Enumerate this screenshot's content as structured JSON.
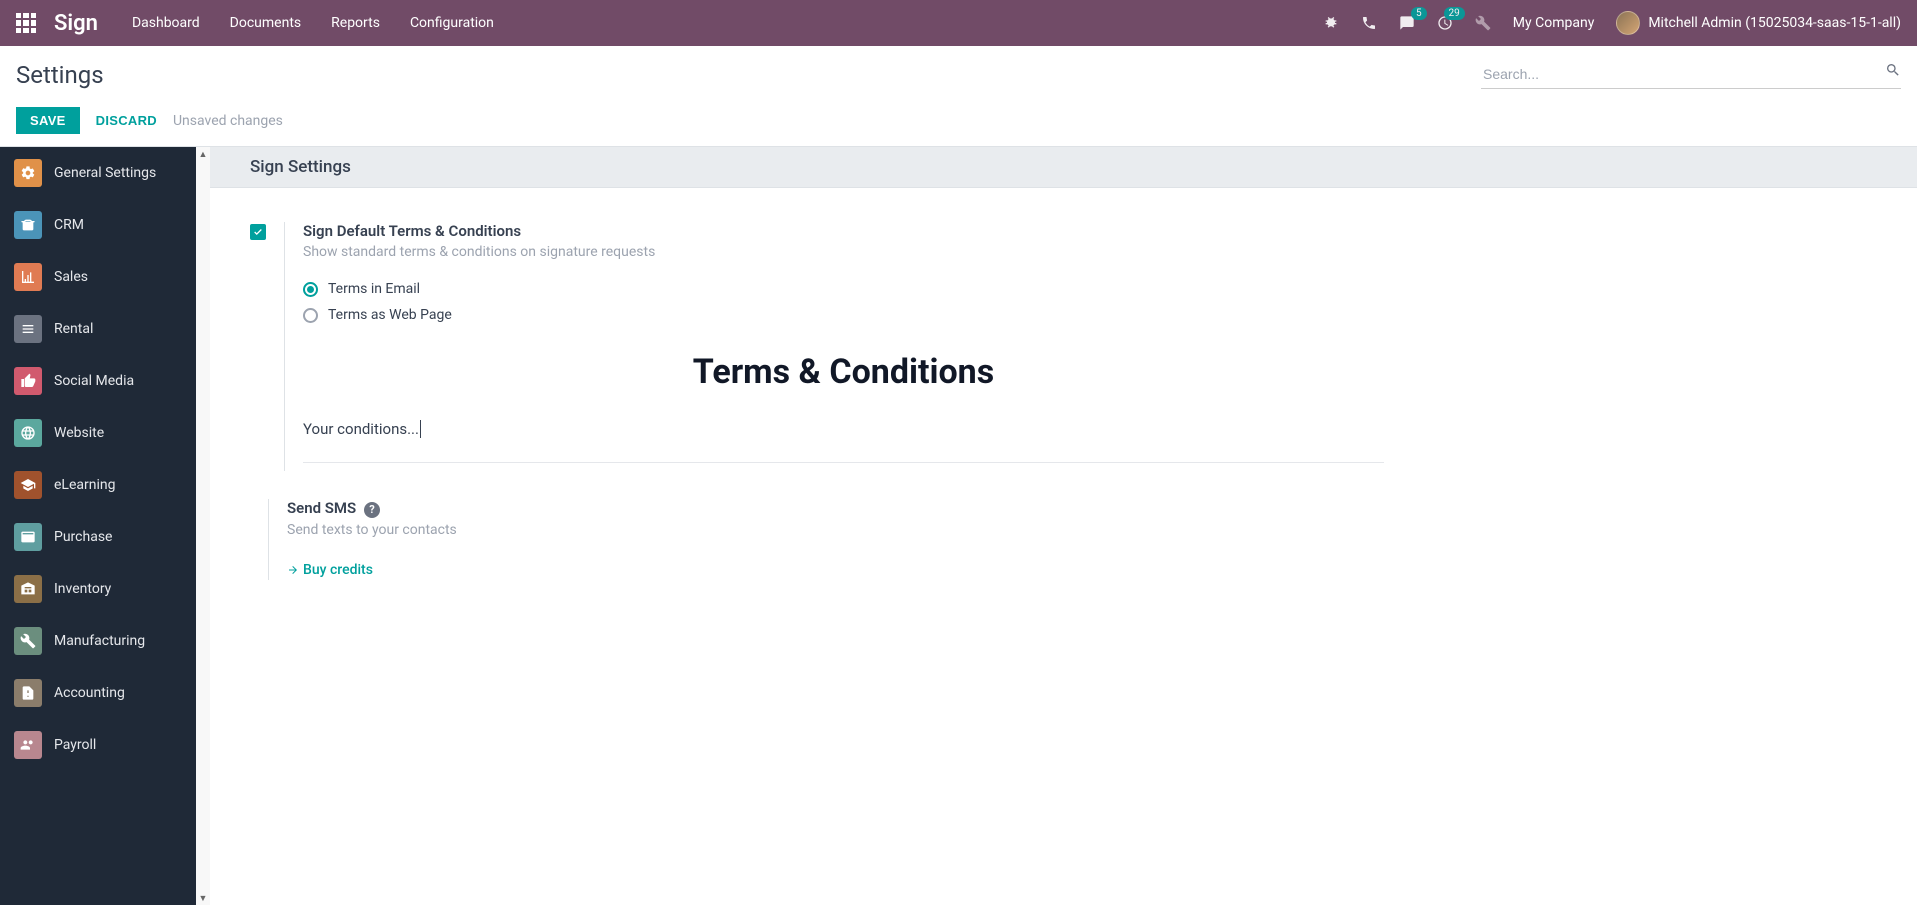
{
  "navbar": {
    "brand": "Sign",
    "menu": [
      "Dashboard",
      "Documents",
      "Reports",
      "Configuration"
    ],
    "messages_badge": "5",
    "activities_badge": "29",
    "company": "My Company",
    "user": "Mitchell Admin (15025034-saas-15-1-all)"
  },
  "control": {
    "breadcrumb": "Settings",
    "search_placeholder": "Search...",
    "save": "SAVE",
    "discard": "DISCARD",
    "unsaved": "Unsaved changes"
  },
  "sidebar": [
    {
      "icon": "general",
      "label": "General Settings"
    },
    {
      "icon": "crm",
      "label": "CRM"
    },
    {
      "icon": "sales",
      "label": "Sales"
    },
    {
      "icon": "rental",
      "label": "Rental"
    },
    {
      "icon": "social",
      "label": "Social Media"
    },
    {
      "icon": "website",
      "label": "Website"
    },
    {
      "icon": "elearn",
      "label": "eLearning"
    },
    {
      "icon": "purchase",
      "label": "Purchase"
    },
    {
      "icon": "inventory",
      "label": "Inventory"
    },
    {
      "icon": "mfg",
      "label": "Manufacturing"
    },
    {
      "icon": "acct",
      "label": "Accounting"
    },
    {
      "icon": "payroll",
      "label": "Payroll"
    }
  ],
  "page": {
    "header": "Sign Settings",
    "terms": {
      "title": "Sign Default Terms & Conditions",
      "desc": "Show standard terms & conditions on signature requests",
      "opt_email": "Terms in Email",
      "opt_web": "Terms as Web Page",
      "heading": "Terms & Conditions",
      "body": "Your conditions..."
    },
    "sms": {
      "title": "Send SMS",
      "desc": "Send texts to your contacts",
      "buy": "Buy credits"
    }
  }
}
